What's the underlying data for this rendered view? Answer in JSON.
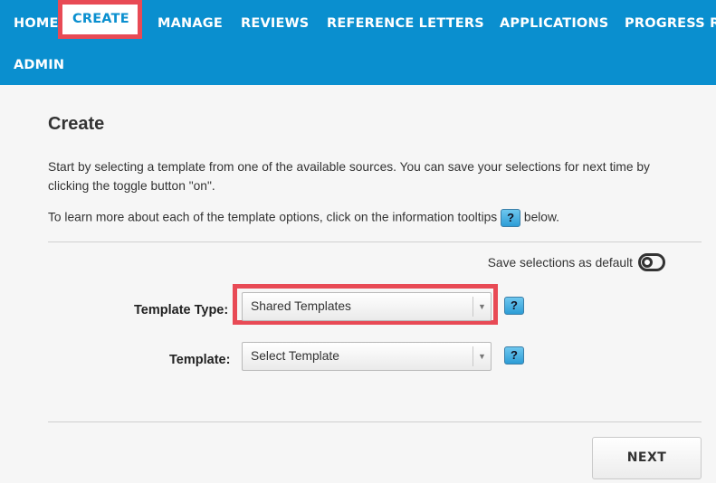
{
  "nav": {
    "items": [
      {
        "label": "HOME"
      },
      {
        "label": "CREATE"
      },
      {
        "label": "MANAGE"
      },
      {
        "label": "REVIEWS"
      },
      {
        "label": "REFERENCE LETTERS"
      },
      {
        "label": "APPLICATIONS"
      },
      {
        "label": "PROGRESS R"
      },
      {
        "label": "ADMIN"
      }
    ],
    "active": "CREATE"
  },
  "page": {
    "title": "Create",
    "intro": "Start by selecting a template from one of the available sources. You can save your selections for next time by clicking the toggle button \"on\".",
    "tooltip_hint_before": "To learn more about each of the template options, click on the information tooltips",
    "tooltip_hint_after": "below.",
    "help_symbol": "?"
  },
  "save_default": {
    "label": "Save selections as default",
    "state": "off"
  },
  "form": {
    "template_type": {
      "label": "Template Type:",
      "value": "Shared Templates"
    },
    "template": {
      "label": "Template:",
      "value": "Select Template"
    }
  },
  "actions": {
    "next_label": "NEXT"
  },
  "colors": {
    "nav_background": "#0a8fcf",
    "highlight": "#e84a55",
    "help_button": "#2d9dd6"
  }
}
